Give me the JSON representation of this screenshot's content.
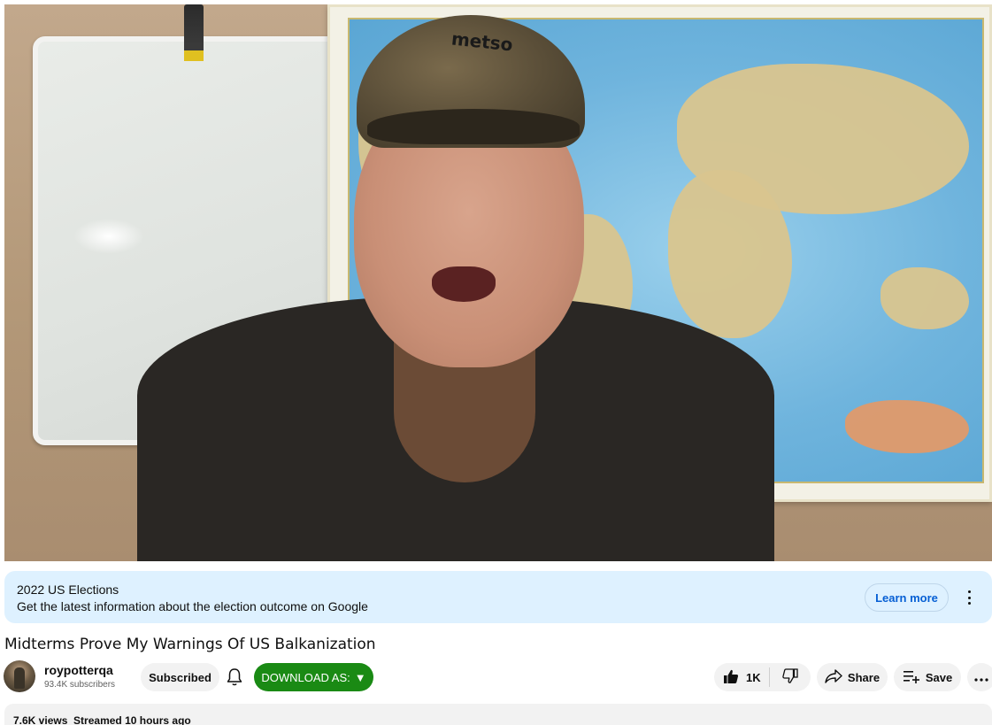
{
  "video": {
    "cap_logo_text": "metso"
  },
  "info_panel": {
    "title": "2022 US Elections",
    "text": "Get the latest information about the election outcome on Google",
    "learn_more_label": "Learn more"
  },
  "title": "Midterms Prove My Warnings Of US Balkanization",
  "channel": {
    "name": "roypotterqa",
    "subscribers": "93.4K subscribers",
    "subscribed_label": "Subscribed",
    "download_label": "DOWNLOAD AS:",
    "download_arrow": "▼"
  },
  "actions": {
    "like_count": "1K",
    "share_label": "Share",
    "save_label": "Save"
  },
  "description": {
    "views": "7.6K views",
    "streamed": "Streamed 10 hours ago"
  },
  "colors": {
    "info_panel_bg": "#def1ff",
    "link_blue": "#065fd4",
    "download_green": "#1a8a14",
    "pill_bg": "#f2f2f2"
  },
  "icons": [
    "bell-icon",
    "thumbs-up-icon",
    "thumbs-down-icon",
    "share-arrow-icon",
    "playlist-add-icon",
    "more-horizontal-icon",
    "more-vertical-icon"
  ]
}
